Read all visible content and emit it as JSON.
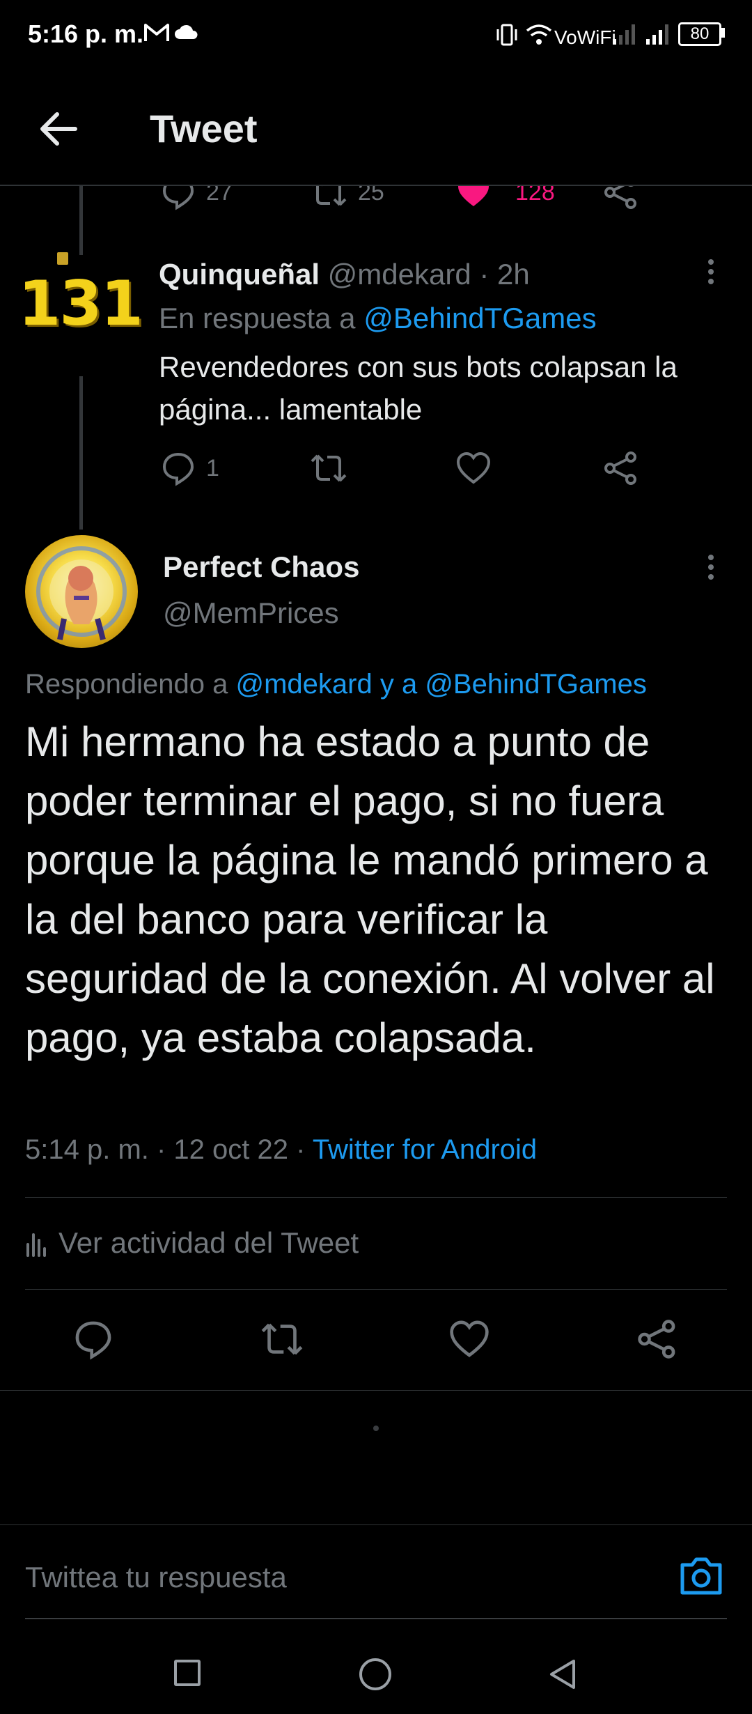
{
  "status_bar": {
    "time": "5:16 p. m.",
    "wifi_label": "VoWiFi",
    "battery": "80"
  },
  "header": {
    "title": "Tweet"
  },
  "prev_tweet_actions": {
    "replies": "27",
    "retweets": "25",
    "likes": "128",
    "like_color": "#f91880"
  },
  "reply_tweet": {
    "avatar_text": "131",
    "display_name": "Quinqueñal",
    "handle": "@mdekard",
    "time": "· 2h",
    "in_reply_prefix": "En respuesta a",
    "in_reply_handle": "@BehindTGames",
    "text": "Revendedores con sus bots colapsan la página... lamentable",
    "replies": "1"
  },
  "main_tweet": {
    "display_name": "Perfect Chaos",
    "handle": "@MemPrices",
    "replying_prefix": "Respondiendo a",
    "replying_handle_1": "@mdekard",
    "replying_joiner": "y a",
    "replying_handle_2": "@BehindTGames",
    "text": "Mi hermano ha estado a punto de poder terminar el pago, si no fuera porque la página le mandó primero a la del banco para verificar la seguridad de la conexión. Al volver al pago, ya estaba colapsada.",
    "timestamp": "5:14 p. m. · 12 oct 22 ·",
    "source": "Twitter for Android",
    "activity_label": "Ver actividad del Tweet"
  },
  "composer": {
    "placeholder": "Twittea tu respuesta"
  },
  "colors": {
    "accent": "#1d9bf0",
    "like": "#f91880",
    "background": "#000000",
    "text": "#e7e9ea",
    "muted": "#71767b"
  }
}
